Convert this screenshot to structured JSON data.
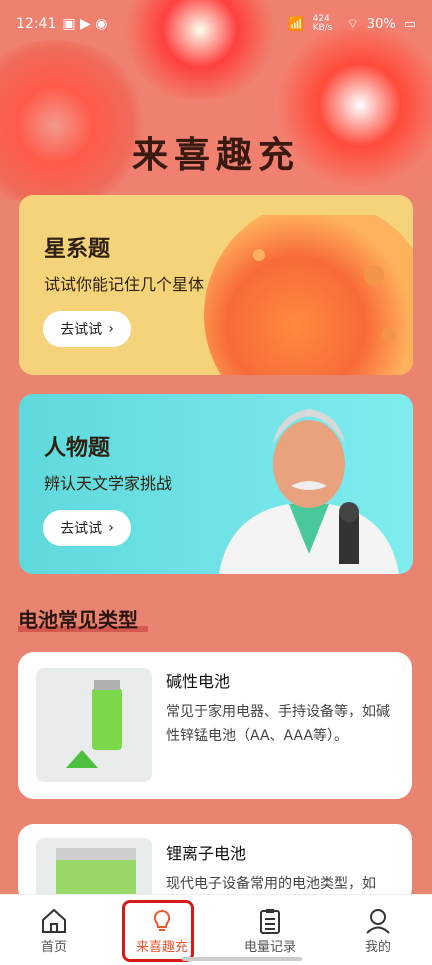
{
  "status_bar": {
    "time": "12:41",
    "net": "424 KB/s",
    "battery": "30%"
  },
  "page_title": "来喜趣充",
  "cards": [
    {
      "title": "星系题",
      "subtitle": "试试你能记住几个星体",
      "button": "去试试"
    },
    {
      "title": "人物题",
      "subtitle": "辨认天文学家挑战",
      "button": "去试试"
    }
  ],
  "section": {
    "title": "电池常见类型"
  },
  "battery_types": [
    {
      "name": "碱性电池",
      "desc": "常见于家用电器、手持设备等，如碱性锌锰电池（AA、AAA等）。"
    },
    {
      "name": "锂离子电池",
      "desc": "现代电子设备常用的电池类型，如"
    }
  ],
  "tabs": [
    {
      "label": "首页",
      "icon": "home-icon"
    },
    {
      "label": "来喜趣充",
      "icon": "bulb-icon",
      "active": true
    },
    {
      "label": "电量记录",
      "icon": "clipboard-icon"
    },
    {
      "label": "我的",
      "icon": "user-icon"
    }
  ],
  "colors": {
    "accent": "#e5572f",
    "card1": "#f5d37a",
    "card2": "#6fe0e4",
    "background": "#e88470"
  }
}
